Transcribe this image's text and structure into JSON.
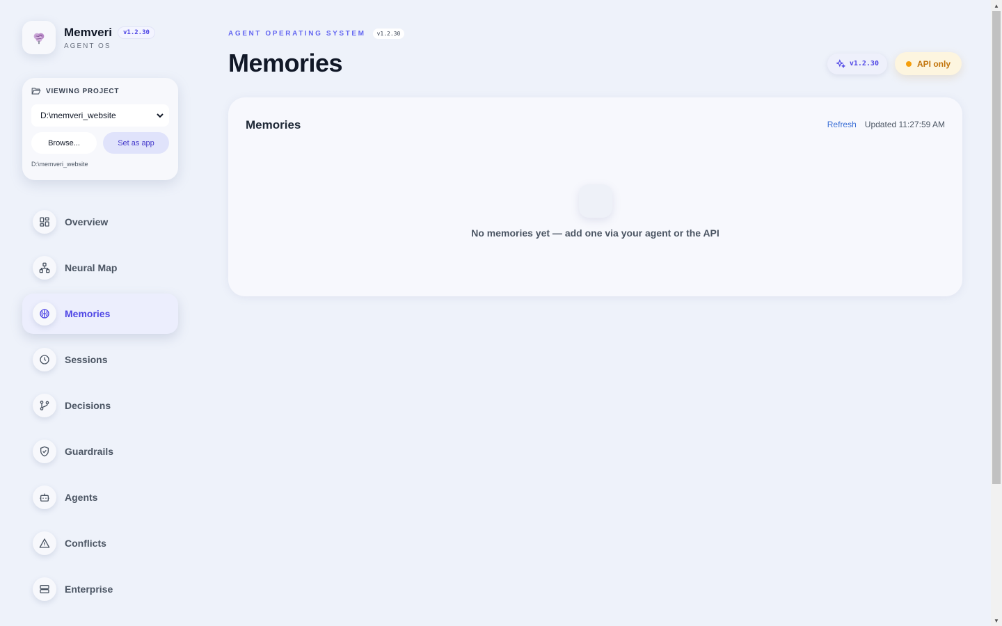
{
  "brand": {
    "name": "Memveri",
    "version": "v1.2.30",
    "subtitle": "AGENT OS"
  },
  "project": {
    "heading": "VIEWING PROJECT",
    "selected": "D:\\memveri_website",
    "browse_label": "Browse...",
    "set_app_label": "Set as app",
    "path": "D:\\memveri_website"
  },
  "nav": {
    "items": [
      {
        "label": "Overview",
        "icon": "grid-icon"
      },
      {
        "label": "Neural Map",
        "icon": "network-icon"
      },
      {
        "label": "Memories",
        "icon": "brain-icon",
        "active": true
      },
      {
        "label": "Sessions",
        "icon": "clock-icon"
      },
      {
        "label": "Decisions",
        "icon": "git-branch-icon"
      },
      {
        "label": "Guardrails",
        "icon": "shield-check-icon"
      },
      {
        "label": "Agents",
        "icon": "bot-icon"
      },
      {
        "label": "Conflicts",
        "icon": "warning-icon"
      },
      {
        "label": "Enterprise",
        "icon": "server-icon"
      }
    ]
  },
  "header": {
    "eyebrow": "AGENT OPERATING SYSTEM",
    "eyebrow_version": "v1.2.30",
    "title": "Memories",
    "version_chip": "v1.2.30",
    "status_chip": "API only"
  },
  "panel": {
    "title": "Memories",
    "refresh_label": "Refresh",
    "updated": "Updated 11:27:59 AM",
    "empty_message": "No memories yet — add one via your agent or the API"
  },
  "colors": {
    "accent": "#4f46e5",
    "background": "#eef2fa",
    "status_warning": "#f59e0b",
    "link": "#3b6fd6"
  }
}
